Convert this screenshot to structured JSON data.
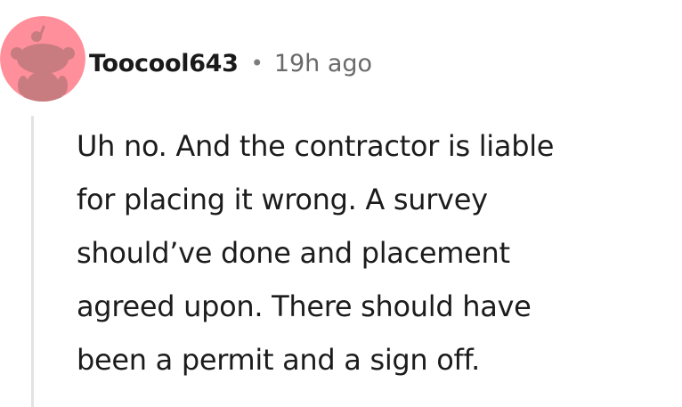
{
  "comment": {
    "author": "Toocool643",
    "separator": "•",
    "timestamp": "19h ago",
    "body_lines": [
      "Uh no. And the contractor is liable",
      "for placing it wrong. A survey",
      "should’ve done and placement",
      "agreed upon. There should have",
      "been a permit and a sign off."
    ]
  },
  "avatar": {
    "icon": "snoo-avatar-icon",
    "background_color": "#ff8f9b",
    "figure_color": "#c87c7f"
  }
}
